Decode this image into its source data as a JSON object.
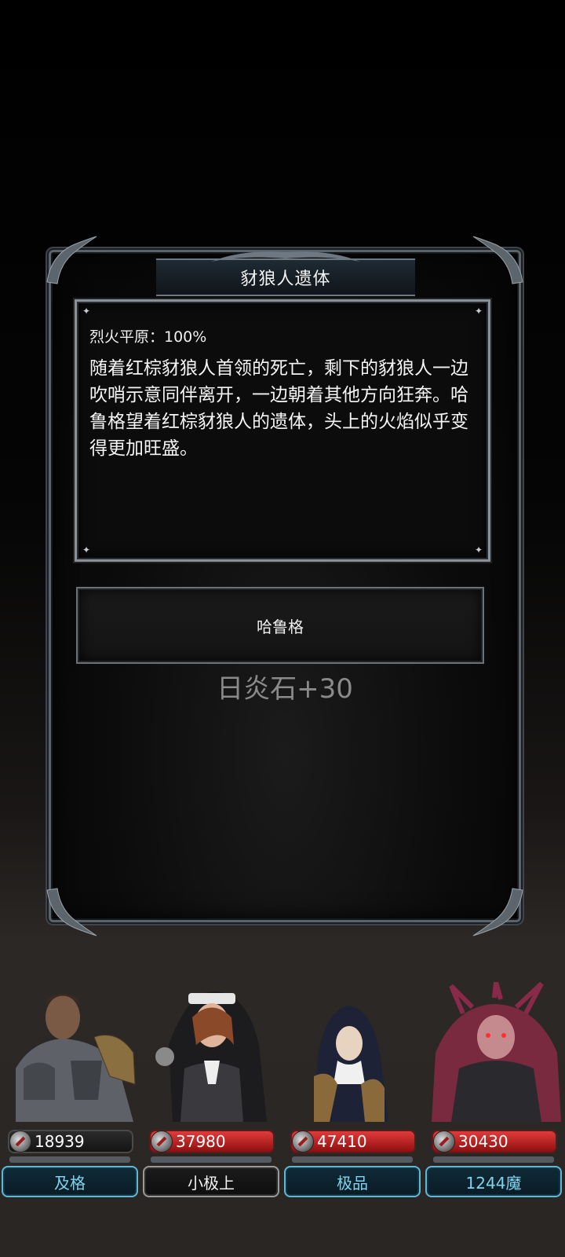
{
  "dialog": {
    "title": "豺狼人遗体",
    "location": "烈火平原：100%",
    "story": "随着红棕豺狼人首领的死亡，剩下的豺狼人一边吹哨示意同伴离开，一边朝着其他方向狂奔。哈鲁格望着红棕豺狼人的遗体，头上的火焰似乎变得更加旺盛。",
    "choice_label": "哈鲁格",
    "reward": "日炎石+30"
  },
  "party": [
    {
      "hp": "18939",
      "rank": "及格",
      "hp_style": "dark",
      "rank_style": "blue"
    },
    {
      "hp": "37980",
      "rank": "小极上",
      "hp_style": "red",
      "rank_style": "gray"
    },
    {
      "hp": "47410",
      "rank": "极品",
      "hp_style": "red",
      "rank_style": "blue"
    },
    {
      "hp": "30430",
      "rank": "1244魔",
      "hp_style": "red",
      "rank_style": "blue"
    }
  ],
  "colors": {
    "hp_red": "#c62828",
    "rank_blue": "#5fb8d6",
    "reward_gray": "#8a8a8a"
  }
}
